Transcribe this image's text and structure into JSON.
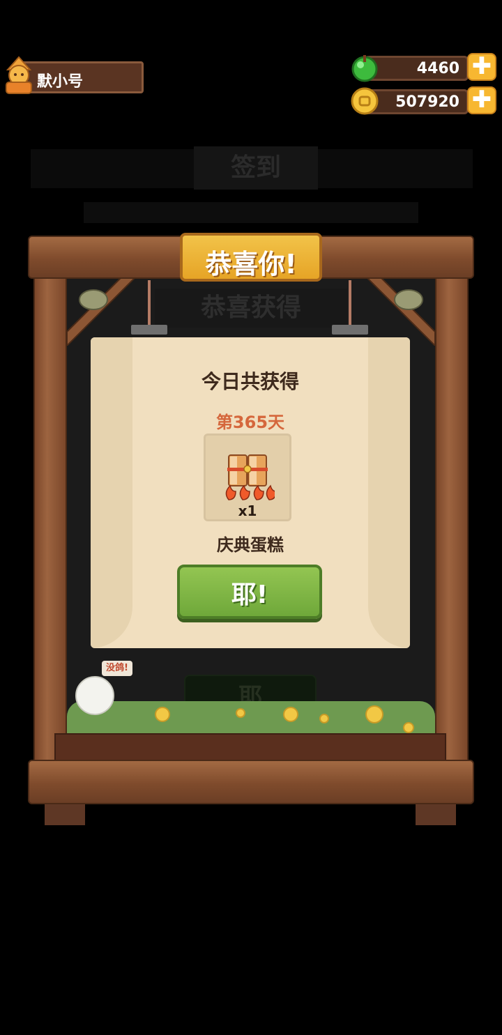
{
  "player": {
    "name": "默小号"
  },
  "resources": {
    "gems": {
      "value": "4460",
      "icon": "green-gem-icon"
    },
    "coins": {
      "value": "507920",
      "icon": "gold-coin-icon"
    },
    "plus_label": "✚"
  },
  "background": {
    "title": "签到",
    "subtitle": "恭喜获得",
    "button": "耶"
  },
  "dialog": {
    "title": "恭喜你!",
    "heading": "今日共获得",
    "day": "第365天",
    "item": {
      "name": "庆典蛋糕",
      "quantity": "x1",
      "icon": "celebration-cake-icon"
    },
    "confirm_label": "耶!"
  },
  "scene": {
    "speech_bubble": "没鸽!"
  },
  "colors": {
    "accent_gold": "#f2c349",
    "confirm_green": "#7fb845",
    "day_text": "#d5673c",
    "parchment": "#f1dfbf"
  }
}
